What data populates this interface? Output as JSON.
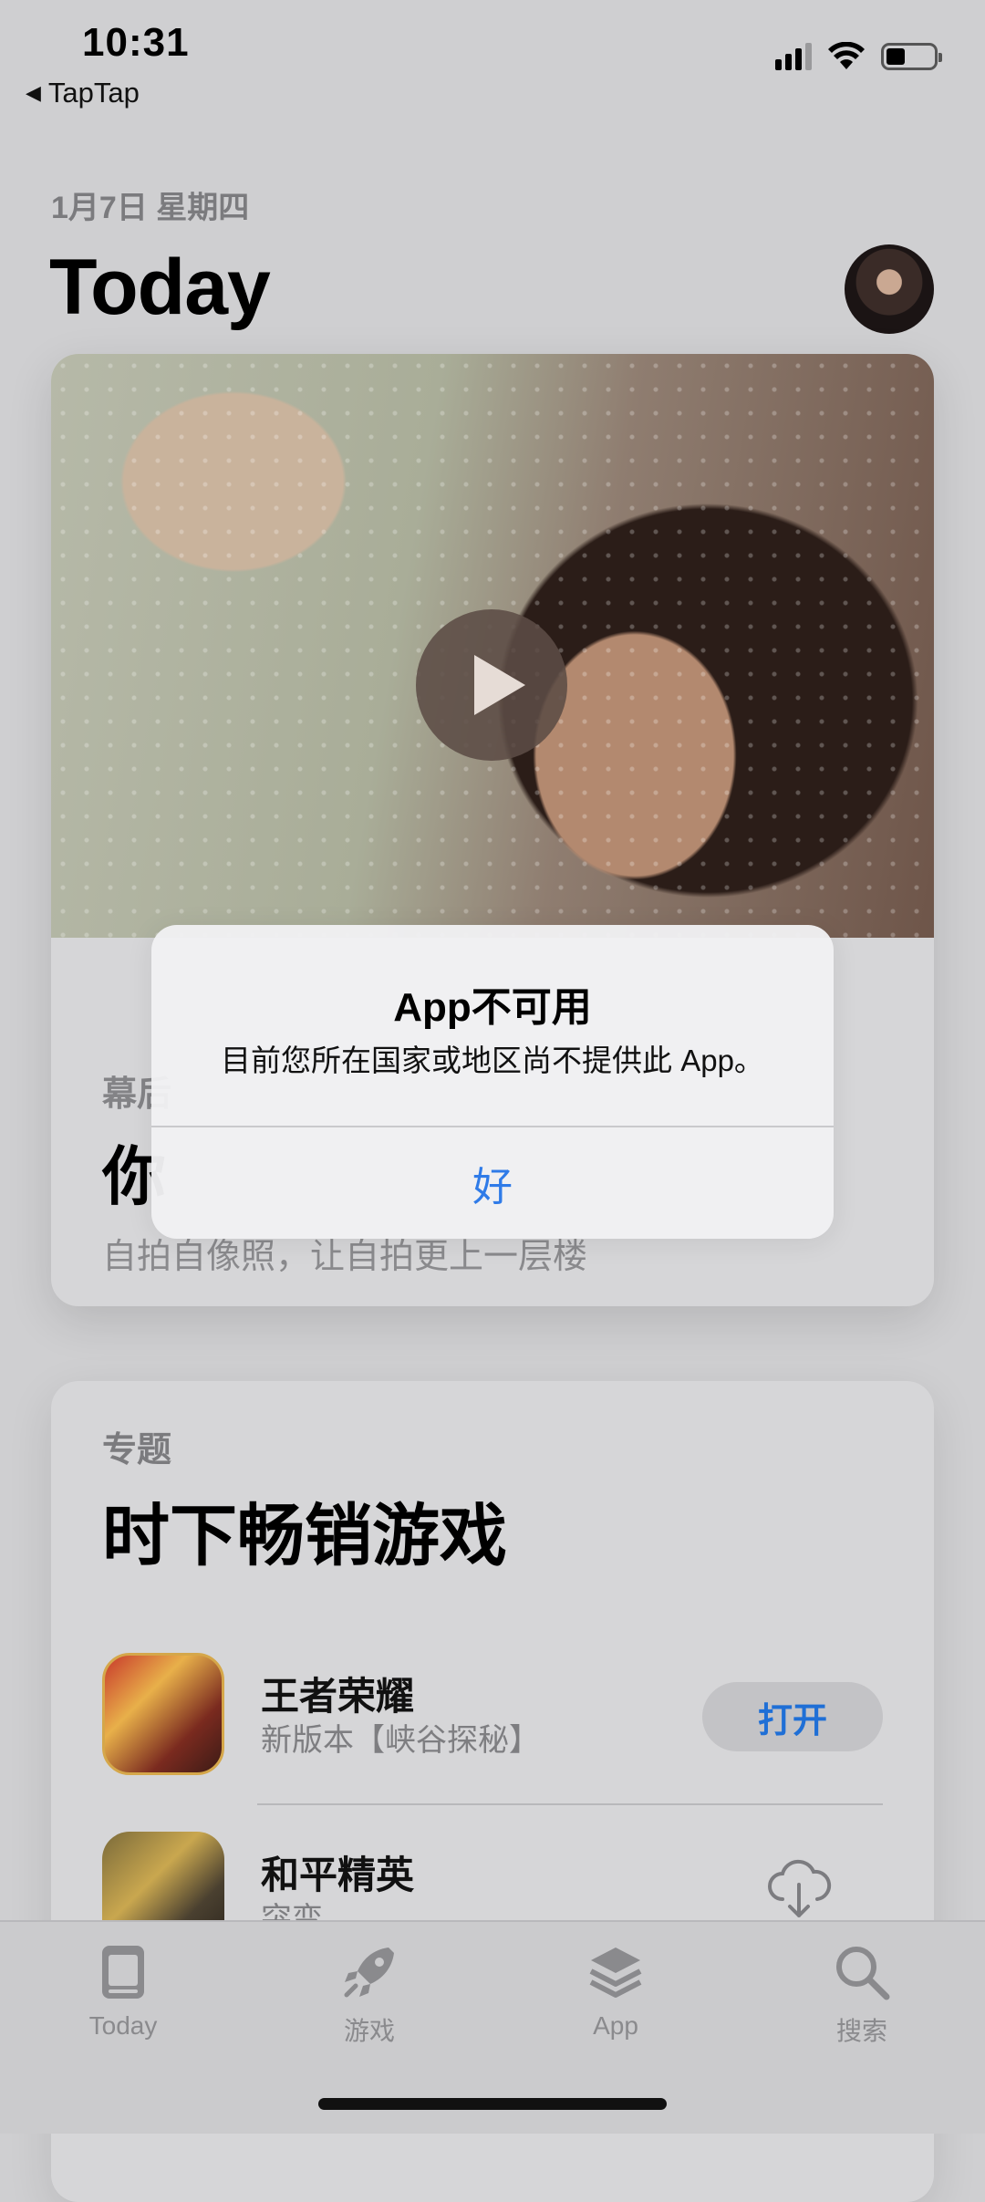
{
  "status_bar": {
    "time": "10:31",
    "back_app": "TapTap",
    "signal_icon": "cellular-signal-icon",
    "wifi_icon": "wifi-icon",
    "battery_icon": "battery-icon",
    "battery_level": 0.4
  },
  "header": {
    "date": "1月7日 星期四",
    "title": "Today"
  },
  "feature_card": {
    "subtitle": "幕后",
    "headline": "你",
    "description": "自拍自像照，让自拍更上一层楼"
  },
  "collection": {
    "label": "专题",
    "title": "时下畅销游戏",
    "apps": [
      {
        "name": "王者荣耀",
        "desc": "新版本【峡谷探秘】",
        "action": "打开"
      },
      {
        "name": "和平精英",
        "desc": "突变",
        "action_icon": "cloud-download-icon"
      }
    ]
  },
  "tab_bar": {
    "tabs": [
      {
        "label": "Today",
        "icon": "today-icon"
      },
      {
        "label": "游戏",
        "icon": "rocket-icon"
      },
      {
        "label": "App",
        "icon": "app-stack-icon"
      },
      {
        "label": "搜索",
        "icon": "search-icon"
      }
    ]
  },
  "alert": {
    "title": "App不可用",
    "message": "目前您所在国家或地区尚不提供此 App。",
    "ok_label": "好"
  },
  "colors": {
    "accent": "#2f7be8",
    "background": "#cfcfd1"
  }
}
